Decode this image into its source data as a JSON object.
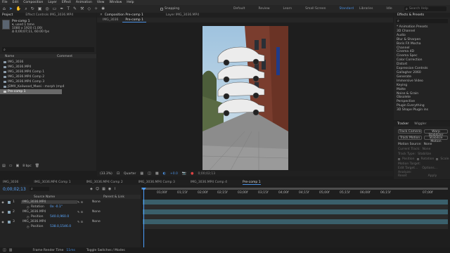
{
  "menu": [
    "File",
    "Edit",
    "Composition",
    "Layer",
    "Effect",
    "Animation",
    "View",
    "Window",
    "Help"
  ],
  "toolbar": {
    "snapping": "Snapping",
    "workspaces": [
      "Default",
      "Review",
      "Learn",
      "Small Screen",
      "Standard",
      "Libraries",
      "Idle"
    ],
    "active_workspace": "Standard",
    "search_placeholder": "Search Help"
  },
  "project": {
    "tabs": [
      "Project",
      "Effect Controls IMG_3036.MP4"
    ],
    "preview_name": "Pre-comp 1",
    "preview_used": "▾, used 1 time",
    "preview_info1": "1080 x 1920 (1.00)",
    "preview_info2": "Δ 0;00;07;11, 60.00 fps",
    "search_placeholder": "",
    "col_name": "Name",
    "col_comment": "Comment",
    "items": [
      "IMG_3036",
      "IMG_3036.MP4",
      "IMG_3036.MP4 Comp 1",
      "IMG_3036.MP4 Comp 2",
      "IMG_3036.MP4 Comp 3",
      "JDMX_Kaliwood_Mwei - morph (mp4",
      "Pre-comp 1"
    ],
    "selected_index": 6,
    "bpc": "8 bpc"
  },
  "comp": {
    "tabs": [
      "Composition Pre-comp 1",
      "Layer IMG_3036.MP4"
    ],
    "subtabs": [
      "IMG_3036",
      "Pre-comp 1"
    ],
    "active_subtab": 1,
    "zoom": "(33.3%)",
    "quality": "Quarter",
    "timecode": "0;00;02;13",
    "exposure": "+0.0"
  },
  "effects": {
    "title": "Effects & Presets",
    "search_placeholder": "",
    "items": [
      "* Animation Presets",
      "3D Channel",
      "Audio",
      "Blur & Sharpen",
      "Boris FX Mocha",
      "Channel",
      "Cinema 4D",
      "Cinema Spec",
      "Color Correction",
      "Distort",
      "Expression Controls",
      "Gallagher 2060",
      "Generate",
      "Immersive Video",
      "Keying",
      "Matte",
      "Noise & Grain",
      "Obsolete",
      "Perspective",
      "Plugin Everything",
      "3D Shape Plugin ins"
    ]
  },
  "tracker": {
    "tabs": [
      "Tracker",
      "Wiggler"
    ],
    "buttons": [
      "Track Camera",
      "Warp Stabilizer",
      "Track Motion",
      "Stabilize Motion"
    ],
    "motion_source_label": "Motion Source:",
    "motion_source": "None",
    "current_track_label": "Current Track:",
    "current_track": "None",
    "track_type_label": "Track Type:",
    "track_type": "Stabilize",
    "checks": [
      "Position",
      "Rotation",
      "Scale"
    ],
    "motion_target_label": "Motion Target:",
    "edit_target": "Edit Target...",
    "options": "Options...",
    "analyze_label": "Analyze:",
    "reset": "Reset",
    "apply": "Apply"
  },
  "timeline": {
    "tabs": [
      "IMG_3036",
      "IMG_3036.MP4 Comp 1",
      "IMG_3036.MP4 Comp 2",
      "IMG_3036.MP4 Comp 3",
      "IMG_3036.MP4 Comp 4",
      "Pre-comp 1"
    ],
    "active_tab": 5,
    "timecode": "0;00;02;13",
    "search_placeholder": "",
    "col_source": "Source Name",
    "col_parent": "Parent & Link",
    "rulers": [
      "01;00f",
      "01;15f",
      "02;00f",
      "02;15f",
      "03;00f",
      "03;15f",
      "04;00f",
      "04;15f",
      "05;00f",
      "05;15f",
      "06;00f",
      "06;15f",
      "07;00f"
    ],
    "layers": [
      {
        "num": "1",
        "name": "IMG_3036.MP4",
        "parent": "None",
        "type": "layer"
      },
      {
        "num": "",
        "name": "Rotation",
        "parent": "0x -0.1°",
        "type": "prop"
      },
      {
        "num": "2",
        "name": "IMG_3036.MP4",
        "parent": "None",
        "type": "layer"
      },
      {
        "num": "",
        "name": "Position",
        "parent": "540.0,960.0",
        "type": "prop"
      },
      {
        "num": "3",
        "name": "IMG_3036.MP4",
        "parent": "None",
        "type": "layer"
      },
      {
        "num": "",
        "name": "Position",
        "parent": "538.0,1546.0",
        "type": "prop"
      }
    ],
    "footer_render": "Frame Render Time",
    "footer_render_value": "11ms",
    "footer_toggle": "Toggle Switches / Modes"
  },
  "colors": {
    "accent": "#4a90e2",
    "timecode": "#5aa7ff",
    "track": "#3a5f6b",
    "playhead": "#4a9fff"
  }
}
